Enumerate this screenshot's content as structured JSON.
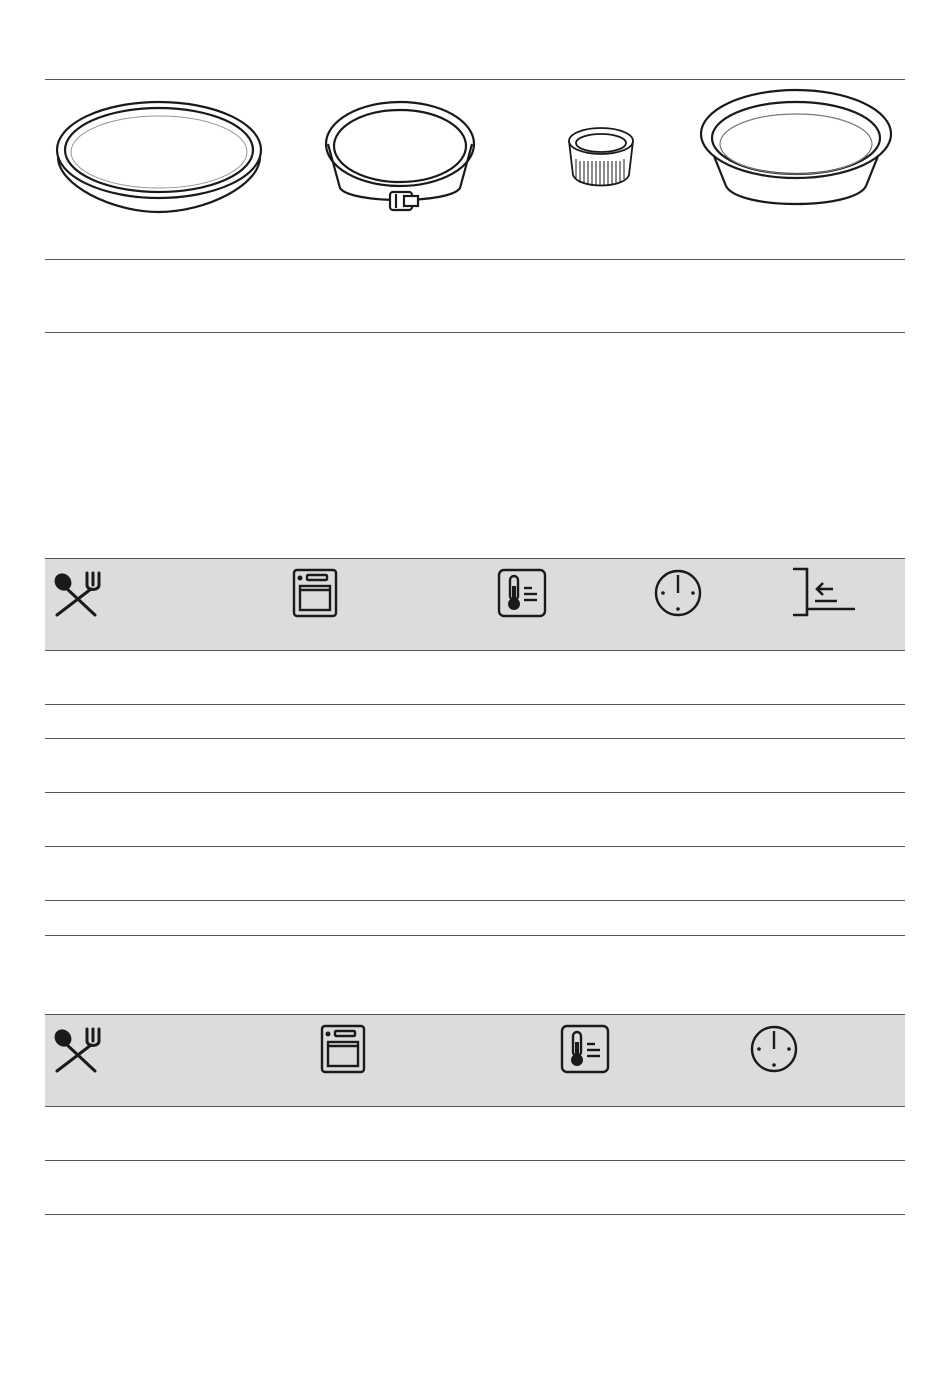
{
  "bakeware": {
    "items": [
      {
        "name": "flan-tin-icon"
      },
      {
        "name": "springform-tin-icon"
      },
      {
        "name": "ramekin-icon"
      },
      {
        "name": "deep-pie-dish-icon"
      }
    ],
    "caption_row": [
      "",
      "",
      "",
      ""
    ]
  },
  "table1": {
    "header_icons": [
      "food-icon",
      "oven-function-icon",
      "temperature-icon",
      "time-icon",
      "shelf-position-icon"
    ],
    "rows": [
      [
        "",
        "",
        "",
        "",
        ""
      ],
      [
        "",
        "",
        "",
        "",
        ""
      ],
      [
        "",
        "",
        "",
        "",
        ""
      ],
      [
        "",
        "",
        "",
        "",
        ""
      ],
      [
        "",
        "",
        "",
        "",
        ""
      ],
      [
        "",
        "",
        "",
        "",
        ""
      ]
    ]
  },
  "table2": {
    "header_icons": [
      "food-icon",
      "oven-function-icon",
      "temperature-icon",
      "time-icon"
    ],
    "rows": [
      [
        "",
        "",
        "",
        ""
      ],
      [
        "",
        "",
        "",
        ""
      ]
    ]
  },
  "colors": {
    "header_bg": "#dcdcdc",
    "rule": "#555555",
    "ink": "#1a1a1a"
  }
}
